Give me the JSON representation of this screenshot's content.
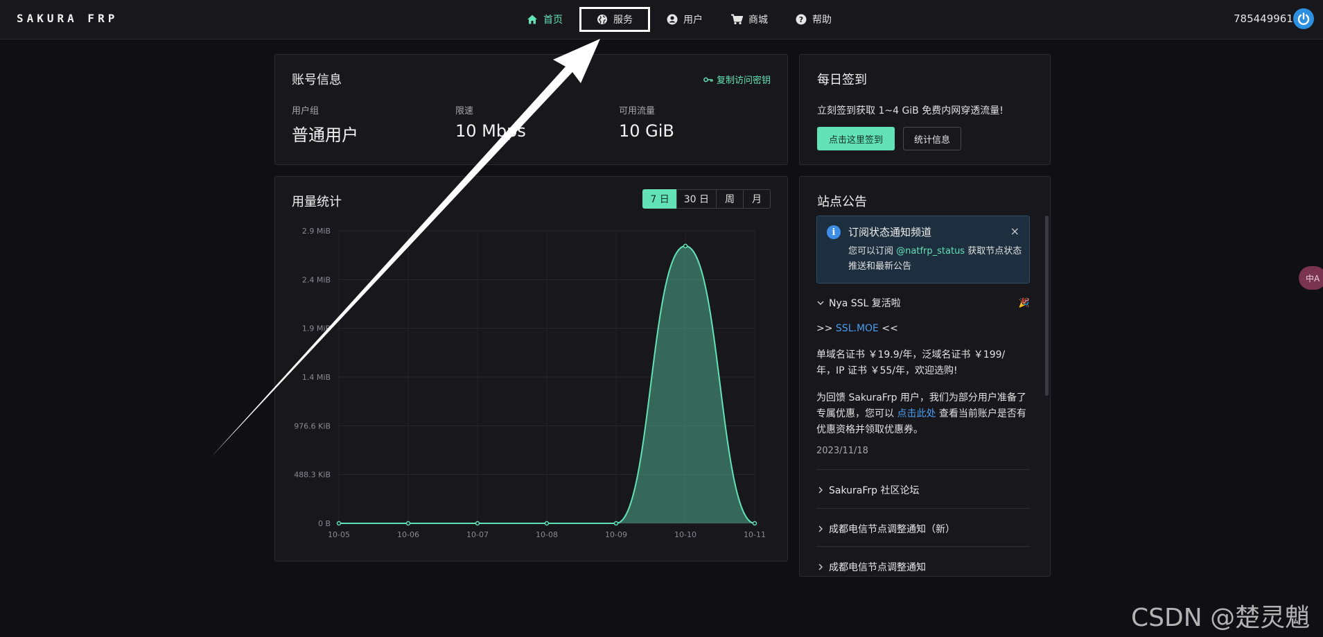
{
  "brand": "SAKURA FRP",
  "nav": [
    {
      "label": "首页",
      "icon": "home-icon"
    },
    {
      "label": "服务",
      "icon": "globe-icon"
    },
    {
      "label": "用户",
      "icon": "user-icon"
    },
    {
      "label": "商城",
      "icon": "cart-icon"
    },
    {
      "label": "帮助",
      "icon": "help-icon"
    }
  ],
  "user_id": "785449961",
  "account": {
    "title": "账号信息",
    "copy_key": "复制访问密钥",
    "stats": [
      {
        "label": "用户组",
        "value": "普通用户"
      },
      {
        "label": "限速",
        "value": "10 Mbps"
      },
      {
        "label": "可用流量",
        "value": "10 GiB"
      }
    ]
  },
  "checkin": {
    "title": "每日签到",
    "text": "立刻签到获取 1~4 GiB 免费内网穿透流量!",
    "sign_button": "点击这里签到",
    "stats_button": "统计信息"
  },
  "usage": {
    "title": "用量统计",
    "ranges": [
      "7 日",
      "30 日",
      "周",
      "月"
    ],
    "active_range": "7 日"
  },
  "chart_data": {
    "type": "area",
    "x": [
      "10-05",
      "10-06",
      "10-07",
      "10-08",
      "10-09",
      "10-10",
      "10-11"
    ],
    "values_mib": [
      0,
      0,
      0,
      0,
      0,
      2.75,
      0
    ],
    "y_ticks": [
      "0 B",
      "488.3 KiB",
      "976.6 KiB",
      "1.4 MiB",
      "1.9 MiB",
      "2.4 MiB",
      "2.9 MiB"
    ],
    "ylim_mib": [
      0,
      2.9
    ],
    "color": "#63e2b7"
  },
  "announcements": {
    "title": "站点公告",
    "notice": {
      "title": "订阅状态通知频道",
      "body_pre": "您可以订阅",
      "body_link": "@natfrp_status",
      "body_post": "获取节点状态推送和最新公告",
      "close": "×"
    },
    "items": [
      {
        "title": "Nya SSL 复活啦",
        "emoji": "🎉"
      },
      {
        "title": "SakuraFrp 社区论坛"
      },
      {
        "title": "成都电信节点调整通知（新）"
      },
      {
        "title": "成都电信节点调整通知"
      }
    ],
    "ssl_pre": ">>",
    "ssl_link": "SSL.MOE",
    "ssl_post": "<<",
    "price_text": "单域名证书 ￥19.9/年，泛域名证书 ￥199/年，IP 证书 ￥55/年，欢迎选购!",
    "offer_pre": "为回馈 SakuraFrp 用户，我们为部分用户准备了专属优惠，您可以",
    "offer_link": "点击此处",
    "offer_post": "查看当前账户是否有优惠资格并领取优惠券。",
    "date": "2023/11/18"
  },
  "side_badge": "中A",
  "watermark": "CSDN @楚灵魈"
}
